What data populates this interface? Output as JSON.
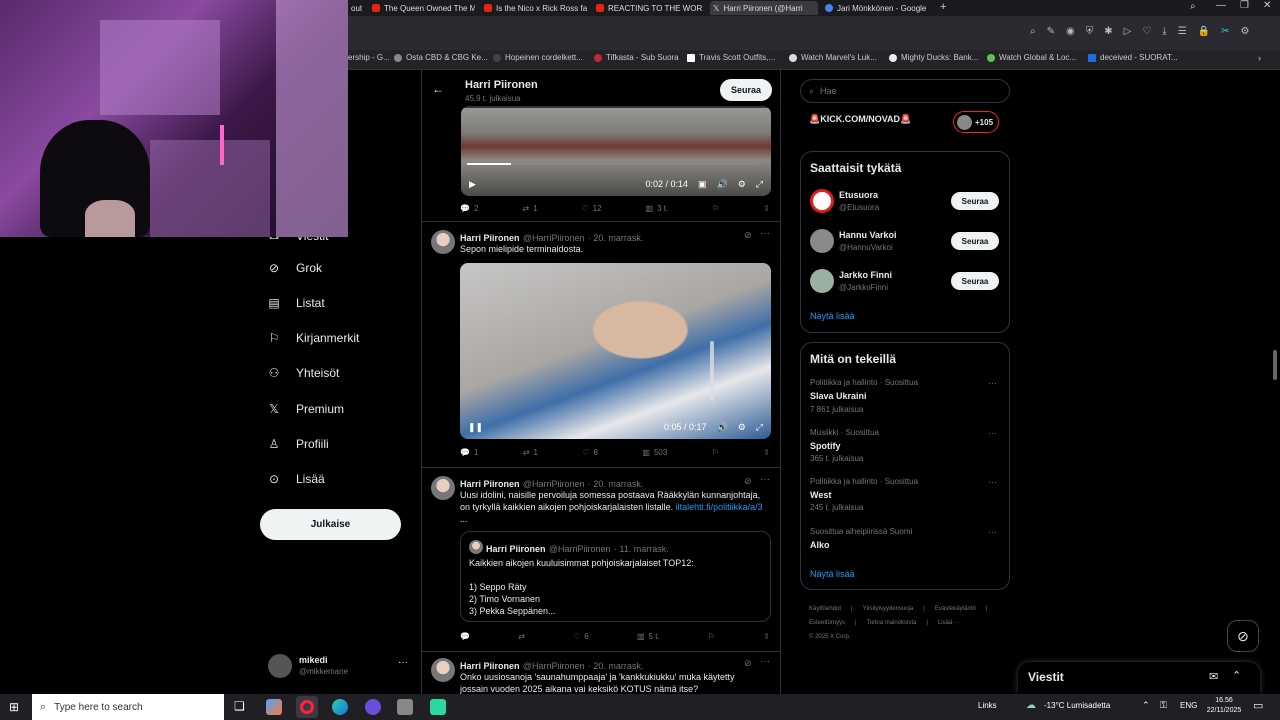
{
  "browser": {
    "tabs": [
      "The Queen Owned The M",
      "Is the Nico x Rick Ross fal",
      "REACTING TO THE WORST",
      "Harri Piironen (@Harri",
      "Jari Mönkkönen - Google"
    ],
    "tab_partial": "outT",
    "bookmarks": [
      "ership - G...",
      "Osta CBD & CBG Ke...",
      "Hopeinen cordelkett...",
      "Tifkasta - Sub Suora",
      "Travis Scott Outfits,...",
      "Watch Marvel's Luk...",
      "Mighty Ducks: Bank...",
      "Watch Global & Loc...",
      "deceived - SUORAT..."
    ]
  },
  "webcam": {
    "partial_text": "et"
  },
  "nav": {
    "partial_item": "Viestit",
    "items": [
      "Grok",
      "Listat",
      "Kirjanmerkit",
      "Yhteisöt",
      "Premium",
      "Profiili",
      "Lisää"
    ],
    "post_button": "Julkaise",
    "account_name": "mikedi",
    "account_handle": "@mikkemane"
  },
  "header": {
    "name": "Harri Piironen",
    "posts": "45,9 t. julkaisua",
    "follow": "Seuraa"
  },
  "tweets": [
    {
      "video_time": "0:02 / 0:14",
      "replies": "2",
      "reposts": "1",
      "likes": "12",
      "views": "3 t."
    },
    {
      "name": "Harri Piironen",
      "handle": "@HarriPiironen",
      "date": "· 20. marrask.",
      "text": "Sepon mielipide terminaidosta.",
      "video_time": "0:05 / 0:17",
      "replies": "1",
      "reposts": "1",
      "likes": "8",
      "views": "503"
    },
    {
      "name": "Harri Piironen",
      "handle": "@HarriPiironen",
      "date": "· 20. marrask.",
      "text_line1": "Uusi idolini, naisille pervoiluja somessa postaava Rääkkylän kunnanjohtaja,",
      "text_line2": "on tyrkyllä kaikkien aikojen pohjoiskarjalaisten listalle.",
      "link": "iltalehti.fi/politiikka/a/3",
      "ellipsis": "...",
      "quote": {
        "name": "Harri Piironen",
        "handle": "@HarriPiironen",
        "date": "· 11. marrask.",
        "line1": "Kaikkien aikojen kuuluisimmat pohjoiskarjalaiset TOP12:",
        "line2": "1) Seppo Räty",
        "line3": "2) Timo Vornanen",
        "line4": "3) Pekka Seppänen..."
      },
      "likes": "6",
      "views": "5 t."
    },
    {
      "name": "Harri Piironen",
      "handle": "@HarriPiironen",
      "date": "· 20. marrask.",
      "text_line1": "Onko uusiosanoja 'saunahumppaaja' ja 'kankkukiukku' muka käytetty",
      "text_line2": "jossain vuoden 2025 aikana vai keksikö KOTUS nämä itse?"
    }
  ],
  "right": {
    "search_placeholder": "Hae",
    "kick_text": "🚨KICK.COM/NOVAD🚨",
    "kick_count": "+105",
    "suggest_title": "Saattaisit tykätä",
    "suggestions": [
      {
        "name": "Etusuora",
        "handle": "@Etusuora",
        "follow": "Seuraa"
      },
      {
        "name": "Hannu Varkoi",
        "handle": "@HannuVarkoi",
        "follow": "Seuraa"
      },
      {
        "name": "Jarkko Finni",
        "handle": "@JarkkoFinni",
        "follow": "Seuraa"
      }
    ],
    "suggest_more": "Näytä lisää",
    "trends_title": "Mitä on tekeillä",
    "trends": [
      {
        "context": "Politiikka ja hallinto · Suosittua",
        "name": "Slava Ukraini",
        "count": "7 861 julkaisua"
      },
      {
        "context": "Musiikki · Suosittua",
        "name": "Spotify",
        "count": "365 t. julkaisua"
      },
      {
        "context": "Politiikka ja hallinto · Suosittua",
        "name": "West",
        "count": "245 t. julkaisua"
      },
      {
        "context": "Suosittua aiheipiirissä Suomi",
        "name": "Alko",
        "count": ""
      }
    ],
    "trends_more": "Näytä lisää",
    "footer_line1": [
      "Käyttöehdot",
      "Yksityisyydensuoja",
      "Evästekäytäntö"
    ],
    "footer_line2": [
      "Esteettömyys",
      "Tietoa mainoksista",
      "Lisää ···"
    ],
    "copyright": "© 2025 X Corp.",
    "messages": "Viestit"
  },
  "taskbar": {
    "search_placeholder": "Type here to search",
    "links": "Links",
    "weather": "-13°C Lumisadetta",
    "lang": "ENG",
    "time": "16.56",
    "date": "22/11/2025"
  }
}
